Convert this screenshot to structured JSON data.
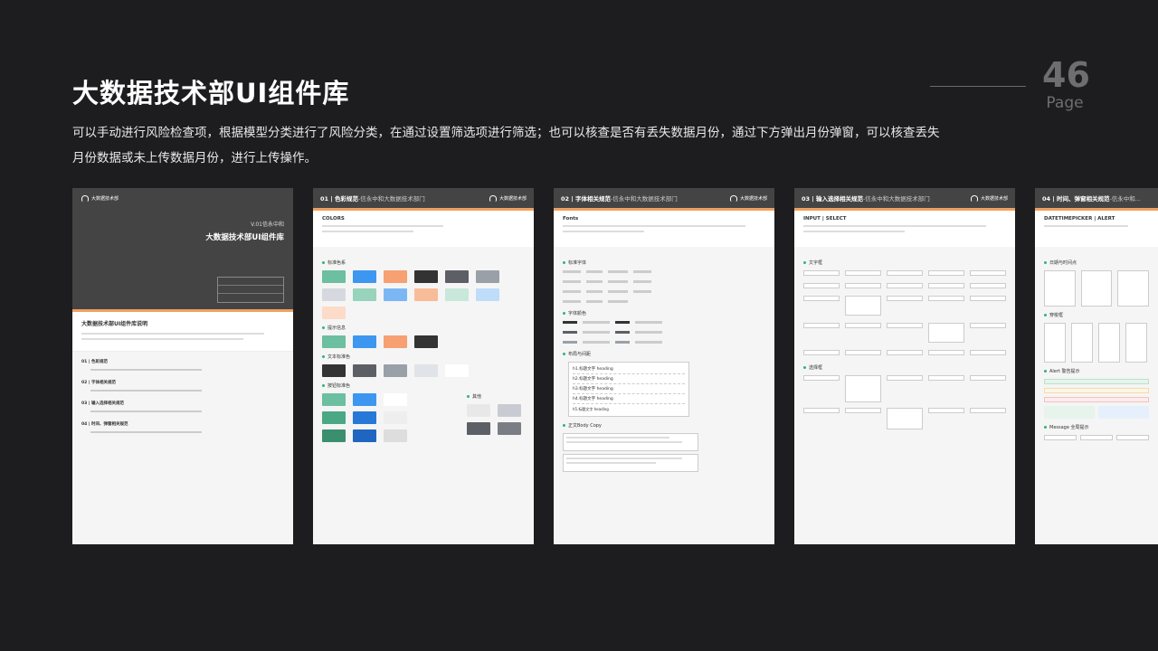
{
  "header": {
    "title": "大数据技术部UI组件库",
    "description": "可以手动进行风险检查项，根据模型分类进行了风险分类，在通过设置筛选项进行筛选；也可以核查是否有丢失数据月份，通过下方弹出月份弹窗，可以核查丢失月份数据或未上传数据月份，进行上传操作。",
    "page_number": "46",
    "page_word": "Page"
  },
  "cards": {
    "cover": {
      "version": "V.01信永中和",
      "title": "大数据技术部UI组件库",
      "section_title": "大数据技术部UI组件库说明",
      "toc": [
        "01 | 色彩规范",
        "02 | 字体相关规范",
        "03 | 输入选择相关规范",
        "04 | 时间、弹窗相关规范"
      ]
    },
    "c1": {
      "number": "01",
      "name": "色彩规范",
      "sub": "-信永中和大数据技术部门",
      "intro": "COLORS",
      "sections": [
        "标准色系",
        "提示信息",
        "文本标准色",
        "按钮标准色",
        "其他"
      ]
    },
    "c2": {
      "number": "02",
      "name": "字体相关规范",
      "sub": "-信永中和大数据技术部门",
      "intro": "Fonts",
      "sections": [
        "标准字体",
        "字体颜色",
        "布局与间距",
        "正文Body Copy"
      ],
      "headings": [
        "h1.标题文字 heading",
        "h2.标题文字 heading",
        "h3.标题文字 heading",
        "h4.标题文字 heading",
        "h5.标题文字 heading"
      ]
    },
    "c3": {
      "number": "03",
      "name": "输入选择相关规范",
      "sub": "-信永中和大数据技术部门",
      "intro": "INPUT | SELECT",
      "sections": [
        "文字框",
        "选择框"
      ]
    },
    "c4": {
      "number": "04",
      "name": "时间、弹窗相关规范",
      "sub": "-信永中和...",
      "intro": "DATETIMEPICKER | ALERT",
      "sections": [
        "日期与时间点",
        "穿梭框",
        "Alert 警告提示",
        "Message 全局提示"
      ]
    },
    "logo_text": "大数据技术部"
  },
  "colors": {
    "accent": "#f0a060",
    "header_bg": "#444444",
    "page_bg": "#1d1d1f",
    "green": "#2bb673"
  }
}
